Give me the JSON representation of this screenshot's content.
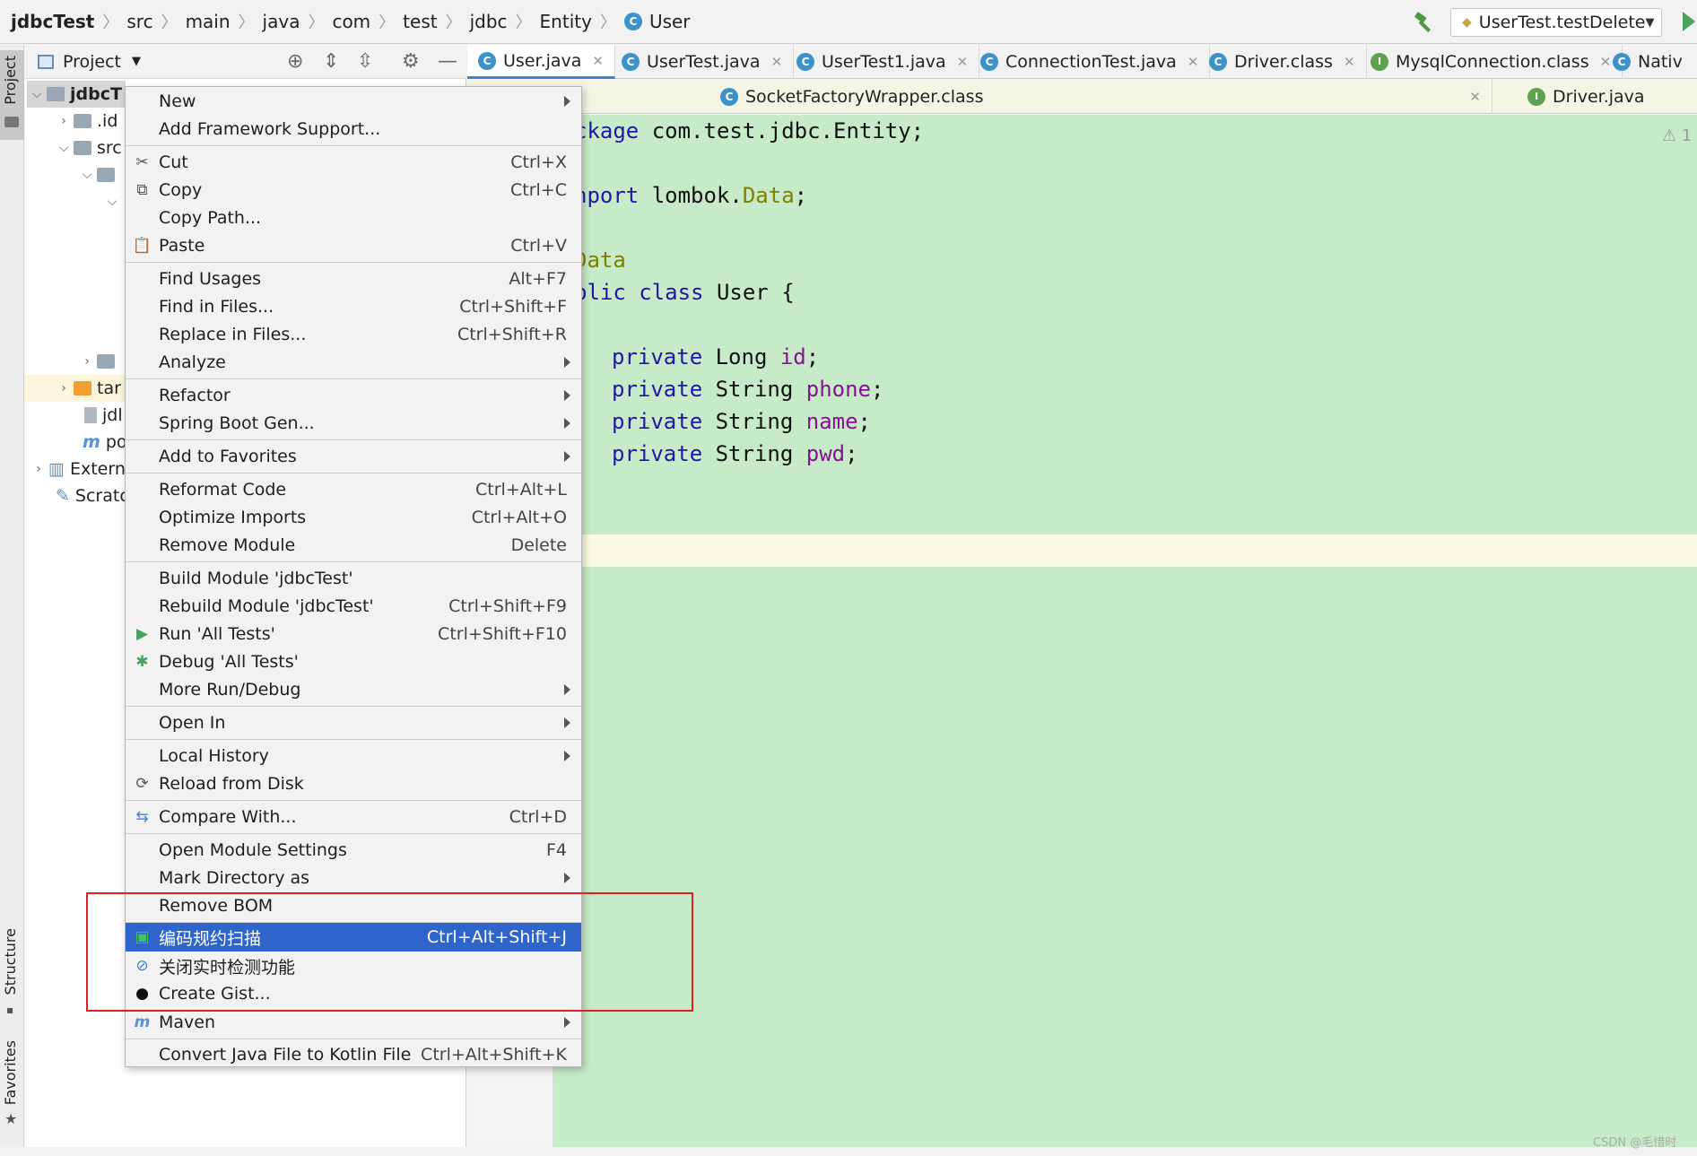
{
  "breadcrumb": {
    "items": [
      "jdbcTest",
      "src",
      "main",
      "java",
      "com",
      "test",
      "jdbc",
      "Entity",
      "User"
    ]
  },
  "run_config": {
    "label": "UserTest.testDelete"
  },
  "project_panel": {
    "title": "Project",
    "tree": [
      {
        "label": "jdbcT",
        "bold": true
      },
      {
        "label": ".id"
      },
      {
        "label": "src"
      },
      {
        "label": ""
      },
      {
        "label": ""
      },
      {
        "label": ""
      },
      {
        "label": "tar"
      },
      {
        "label": "jdl"
      },
      {
        "label": "po"
      },
      {
        "label": "Extern"
      },
      {
        "label": "Scratc"
      }
    ]
  },
  "left_strip": {
    "project": "Project",
    "structure": "Structure",
    "favorites": "Favorites"
  },
  "tabs": [
    {
      "label": "User.java",
      "icon": "C",
      "active": true
    },
    {
      "label": "UserTest.java",
      "icon": "C"
    },
    {
      "label": "UserTest1.java",
      "icon": "C"
    },
    {
      "label": "ConnectionTest.java",
      "icon": "C"
    },
    {
      "label": "Driver.class",
      "icon": "C"
    },
    {
      "label": "MysqlConnection.class",
      "icon": "I"
    },
    {
      "label": "Nativ",
      "icon": "C"
    }
  ],
  "tabs_row2": [
    {
      "label": "SocketFactoryWrapper.class",
      "icon": "C"
    },
    {
      "label": "Driver.java",
      "icon": "I"
    }
  ],
  "editor": {
    "lines": [
      {
        "parts": [
          [
            "kw",
            "ckage"
          ],
          [
            "",
            " com.test.jdbc.Entity;"
          ]
        ]
      },
      {
        "parts": [
          [
            "kw",
            "nport"
          ],
          [
            "",
            " lombok."
          ],
          [
            "ann",
            "Data"
          ],
          [
            "",
            ";"
          ]
        ]
      },
      {
        "parts": [
          [
            "ann",
            "Data"
          ]
        ]
      },
      {
        "parts": [
          [
            "kw",
            "blic class"
          ],
          [
            "",
            " User {"
          ]
        ]
      },
      {
        "parts": [
          [
            "kw",
            "private"
          ],
          [
            "",
            " Long "
          ],
          [
            "fld",
            "id"
          ],
          [
            "",
            ";"
          ]
        ]
      },
      {
        "parts": [
          [
            "kw",
            "private"
          ],
          [
            "",
            " String "
          ],
          [
            "fld",
            "phone"
          ],
          [
            "",
            ";"
          ]
        ]
      },
      {
        "parts": [
          [
            "kw",
            "private"
          ],
          [
            "",
            " String "
          ],
          [
            "fld",
            "name"
          ],
          [
            "",
            ";"
          ]
        ]
      },
      {
        "parts": [
          [
            "kw",
            "private"
          ],
          [
            "",
            " String "
          ],
          [
            "fld",
            "pwd"
          ],
          [
            "",
            ";"
          ]
        ]
      }
    ],
    "warning_count": "1"
  },
  "context_menu": {
    "items": [
      {
        "label": "New",
        "submenu": true
      },
      {
        "label": "Add Framework Support..."
      },
      {
        "label": "Cut",
        "shortcut": "Ctrl+X",
        "icon": "scissors-icon"
      },
      {
        "label": "Copy",
        "shortcut": "Ctrl+C",
        "icon": "copy-icon"
      },
      {
        "label": "Copy Path..."
      },
      {
        "label": "Paste",
        "shortcut": "Ctrl+V",
        "icon": "paste-icon"
      },
      {
        "label": "Find Usages",
        "shortcut": "Alt+F7"
      },
      {
        "label": "Find in Files...",
        "shortcut": "Ctrl+Shift+F"
      },
      {
        "label": "Replace in Files...",
        "shortcut": "Ctrl+Shift+R"
      },
      {
        "label": "Analyze",
        "submenu": true
      },
      {
        "label": "Refactor",
        "submenu": true
      },
      {
        "label": "Spring Boot Gen...",
        "submenu": true
      },
      {
        "label": "Add to Favorites",
        "submenu": true
      },
      {
        "label": "Reformat Code",
        "shortcut": "Ctrl+Alt+L"
      },
      {
        "label": "Optimize Imports",
        "shortcut": "Ctrl+Alt+O"
      },
      {
        "label": "Remove Module",
        "shortcut": "Delete"
      },
      {
        "label": "Build Module 'jdbcTest'"
      },
      {
        "label": "Rebuild Module 'jdbcTest'",
        "shortcut": "Ctrl+Shift+F9"
      },
      {
        "label": "Run 'All Tests'",
        "shortcut": "Ctrl+Shift+F10",
        "icon": "run-icon"
      },
      {
        "label": "Debug 'All Tests'",
        "icon": "debug-icon"
      },
      {
        "label": "More Run/Debug",
        "submenu": true
      },
      {
        "label": "Open In",
        "submenu": true
      },
      {
        "label": "Local History",
        "submenu": true
      },
      {
        "label": "Reload from Disk",
        "icon": "reload-icon"
      },
      {
        "label": "Compare With...",
        "shortcut": "Ctrl+D",
        "icon": "compare-icon"
      },
      {
        "label": "Open Module Settings",
        "shortcut": "F4"
      },
      {
        "label": "Mark Directory as",
        "submenu": true
      },
      {
        "label": "Remove BOM"
      },
      {
        "label": "编码规约扫描",
        "shortcut": "Ctrl+Alt+Shift+J",
        "icon": "scan-icon",
        "selected": true
      },
      {
        "label": "关闭实时检测功能",
        "icon": "disable-icon"
      },
      {
        "label": "Create Gist...",
        "icon": "github-icon"
      },
      {
        "label": "Maven",
        "submenu": true,
        "icon": "maven-icon"
      },
      {
        "label": "Convert Java File to Kotlin File",
        "shortcut": "Ctrl+Alt+Shift+K"
      }
    ]
  },
  "watermark": "CSDN @毛惜时",
  "colors": {
    "editor_bg": "#c7ebc9",
    "selection": "#2f65ca",
    "highlight_box": "#e02020",
    "keyword": "#1a1aa6",
    "field": "#871094",
    "annotation": "#808000"
  }
}
